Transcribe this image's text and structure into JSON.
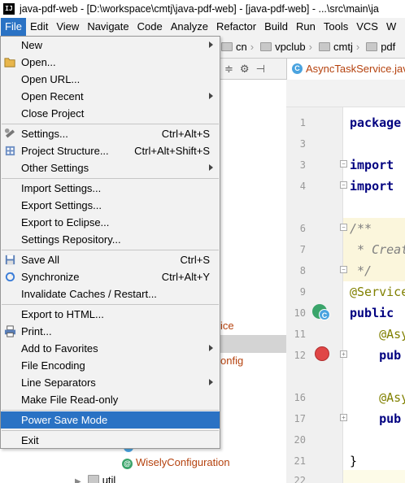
{
  "window": {
    "title": "java-pdf-web - [D:\\workspace\\cmtj\\java-pdf-web] - [java-pdf-web] - ...\\src\\main\\ja",
    "app_icon_label": "IJ"
  },
  "menubar": {
    "items": [
      "File",
      "Edit",
      "View",
      "Navigate",
      "Code",
      "Analyze",
      "Refactor",
      "Build",
      "Run",
      "Tools",
      "VCS",
      "W"
    ]
  },
  "navbar": {
    "crumbs": [
      "cn",
      "vpclub",
      "cmtj",
      "pdf"
    ]
  },
  "project_toolbar": {
    "icons": [
      "collapse-icon",
      "gear-icon",
      "hide-icon"
    ]
  },
  "editor": {
    "tab_label": "AsyncTaskService.java",
    "lines": [
      {
        "n": "1",
        "code": "package"
      },
      {
        "n": "3",
        "code": "import"
      },
      {
        "n": "4",
        "code": "import"
      },
      {
        "n": "6",
        "code": "/**"
      },
      {
        "n": "7",
        "code": " * Creat"
      },
      {
        "n": "8",
        "code": " */"
      },
      {
        "n": "9",
        "code": "@Service"
      },
      {
        "n": "10",
        "code": "public"
      },
      {
        "n": "11",
        "code": "    @Asy"
      },
      {
        "n": "12",
        "code": "    pub"
      },
      {
        "n": "16",
        "code": "    @Asy"
      },
      {
        "n": "17",
        "code": "    pub"
      },
      {
        "n": "21",
        "code": "}"
      },
      {
        "n": "22",
        "code": ""
      }
    ]
  },
  "project_tree": {
    "partial_service": "ice",
    "partial_config": "onfig",
    "wisely": "WiselyConfiguration",
    "util": "util"
  },
  "file_menu": {
    "items": [
      {
        "label": "New",
        "submenu": true
      },
      {
        "label": "Open...",
        "shortcut": ""
      },
      {
        "label": "Open URL...",
        "shortcut": ""
      },
      {
        "label": "Open Recent",
        "submenu": true
      },
      {
        "label": "Close Project",
        "shortcut": ""
      },
      {
        "label": "Settings...",
        "shortcut": "Ctrl+Alt+S"
      },
      {
        "label": "Project Structure...",
        "shortcut": "Ctrl+Alt+Shift+S"
      },
      {
        "label": "Other Settings",
        "submenu": true
      },
      {
        "label": "Import Settings...",
        "shortcut": ""
      },
      {
        "label": "Export Settings...",
        "shortcut": ""
      },
      {
        "label": "Export to Eclipse...",
        "shortcut": ""
      },
      {
        "label": "Settings Repository...",
        "shortcut": ""
      },
      {
        "label": "Save All",
        "shortcut": "Ctrl+S"
      },
      {
        "label": "Synchronize",
        "shortcut": "Ctrl+Alt+Y"
      },
      {
        "label": "Invalidate Caches / Restart...",
        "shortcut": ""
      },
      {
        "label": "Export to HTML...",
        "shortcut": ""
      },
      {
        "label": "Print...",
        "shortcut": ""
      },
      {
        "label": "Add to Favorites",
        "submenu": true
      },
      {
        "label": "File Encoding",
        "shortcut": ""
      },
      {
        "label": "Line Separators",
        "submenu": true
      },
      {
        "label": "Make File Read-only",
        "shortcut": ""
      },
      {
        "label": "Power Save Mode",
        "shortcut": ""
      },
      {
        "label": "Exit",
        "shortcut": ""
      }
    ]
  },
  "colors": {
    "menu_highlight": "#2a72c4",
    "breakpoint": "#e04646",
    "keyword": "#000080",
    "annotation": "#808000"
  }
}
